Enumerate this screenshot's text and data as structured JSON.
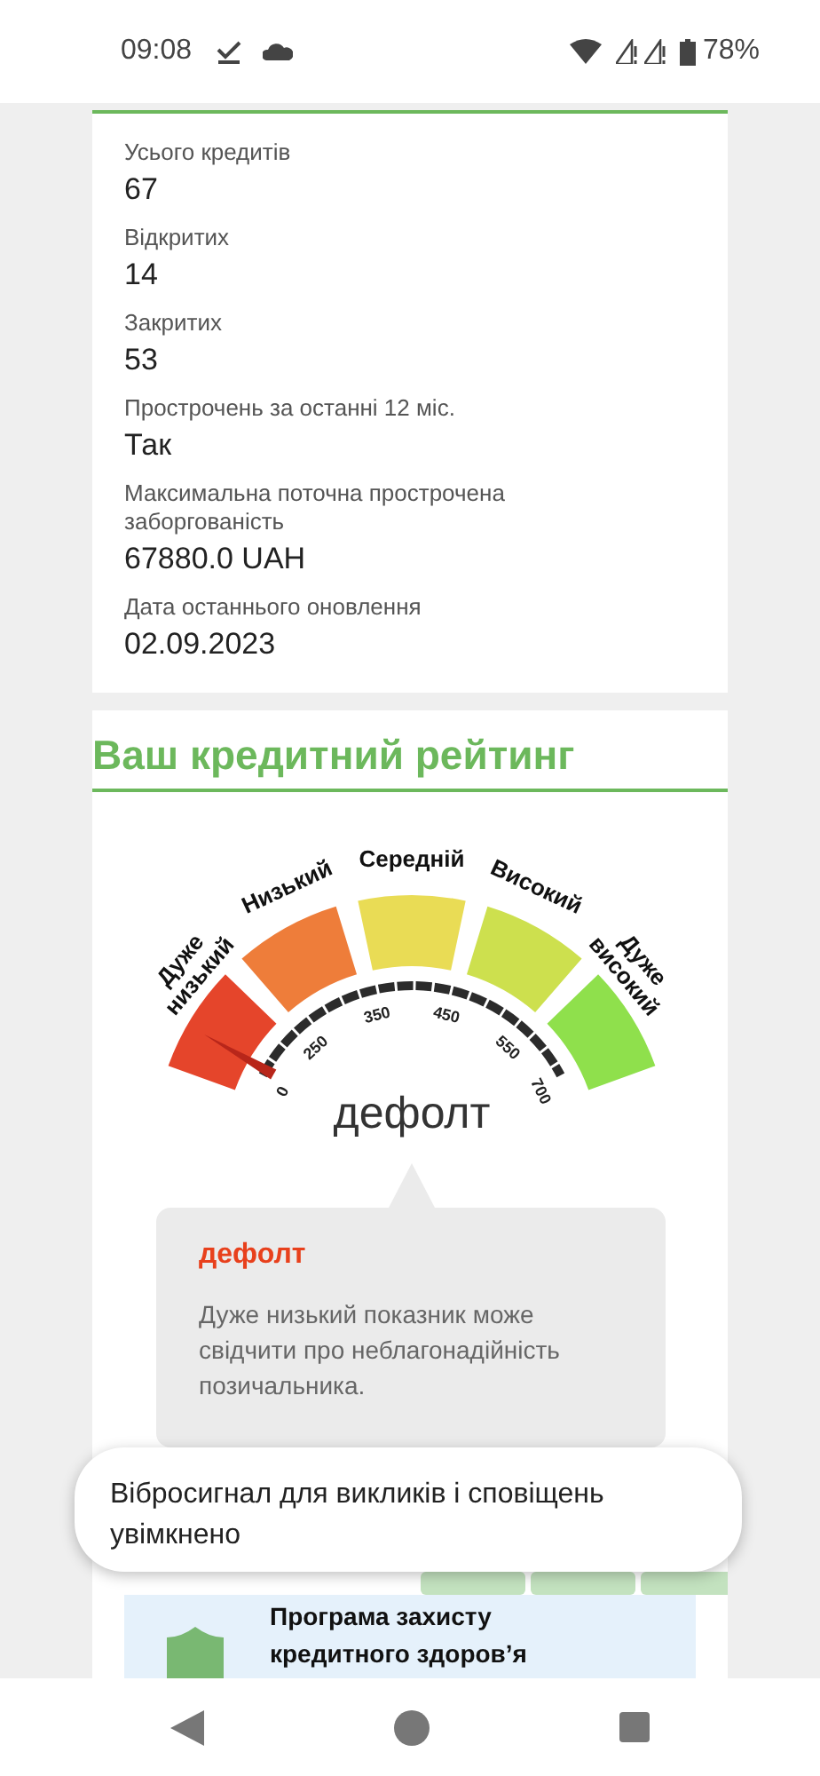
{
  "status_bar": {
    "time": "09:08",
    "battery": "78%"
  },
  "credit_summary": {
    "items": [
      {
        "label": "Усього кредитів",
        "value": "67"
      },
      {
        "label": "Відкритих",
        "value": "14"
      },
      {
        "label": "Закритих",
        "value": "53"
      },
      {
        "label": "Прострочень за останні 12 міс.",
        "value": "Так"
      },
      {
        "label": "Максимальна поточна прострочена заборгованість",
        "value": "67880.0 UAH"
      },
      {
        "label": "Дата останнього оновлення",
        "value": "02.09.2023"
      }
    ]
  },
  "rating": {
    "title": "Ваш кредитний рейтинг",
    "gauge": {
      "bands": [
        {
          "label": "Дуже низький",
          "color": "#e5452b"
        },
        {
          "label": "Низький",
          "color": "#ee7d3a"
        },
        {
          "label": "Середній",
          "color": "#e9dc55"
        },
        {
          "label": "Високий",
          "color": "#cde04e"
        },
        {
          "label": "Дуже високий",
          "color": "#8fe04c"
        }
      ],
      "ticks": [
        "0",
        "250",
        "350",
        "450",
        "550",
        "700"
      ],
      "score_label": "дефолт"
    },
    "tooltip": {
      "title": "дефолт",
      "text": "Дуже низький показник може свідчити про неблагонадійність позичальника."
    }
  },
  "program_card": {
    "title": "Програма захисту кредитного здоров’я"
  },
  "toast": {
    "text": "Вібросигнал для викликів і сповіщень увімкнено"
  }
}
